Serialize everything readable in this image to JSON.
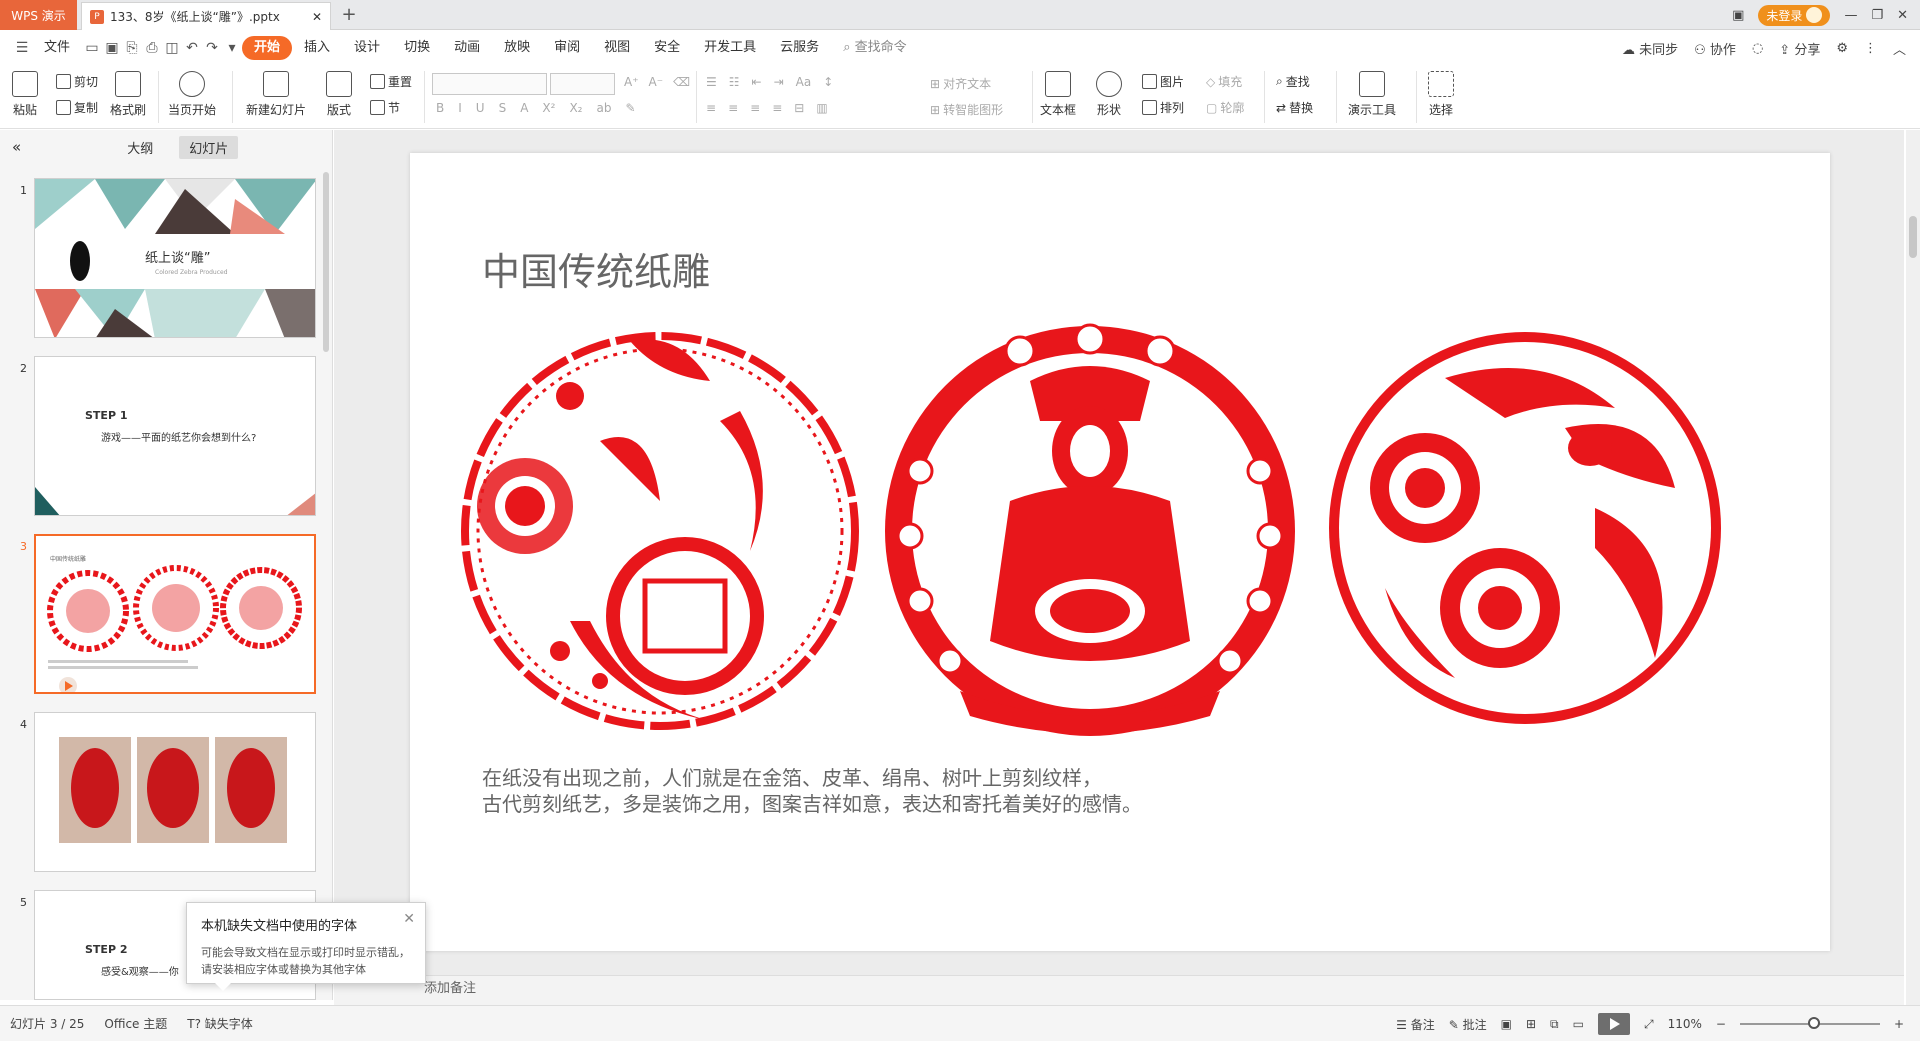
{
  "app_tab": "WPS 演示",
  "doc_tab": {
    "title": "133、8岁《纸上谈“雕”》.pptx"
  },
  "window": {
    "login_label": "未登录"
  },
  "menu": {
    "file": "文件",
    "tabs": [
      "开始",
      "插入",
      "设计",
      "切换",
      "动画",
      "放映",
      "审阅",
      "视图",
      "安全",
      "开发工具",
      "云服务"
    ],
    "active_tab": "开始",
    "search": "查找命令",
    "right": [
      "未同步",
      "协作",
      "分享"
    ]
  },
  "ribbon": {
    "paste": "粘贴",
    "cut": "剪切",
    "copy": "复制",
    "format_painter": "格式刷",
    "from_start": "当页开始",
    "new_slide": "新建幻灯片",
    "layout": "版式",
    "reset": "重置",
    "section": "节",
    "align_text": "对齐文本",
    "smart_art": "转智能图形",
    "textbox": "文本框",
    "shape": "形状",
    "picture": "图片",
    "arrange": "排列",
    "fill": "填充",
    "outline": "轮廓",
    "find": "查找",
    "replace": "替换",
    "present_tools": "演示工具",
    "select": "选择"
  },
  "panel": {
    "tabs": [
      "大纲",
      "幻灯片"
    ],
    "active": "幻灯片",
    "slides": [
      {
        "num": "1",
        "title": "纸上谈“雕”",
        "subtitle": "Colored Zebra Produced"
      },
      {
        "num": "2",
        "step": "STEP 1",
        "text": "游戏——平面的纸艺你会想到什么?"
      },
      {
        "num": "3",
        "title": "中国传统纸雕"
      },
      {
        "num": "4"
      },
      {
        "num": "5",
        "step": "STEP 2",
        "text": "感受&观察——你"
      }
    ]
  },
  "slide": {
    "title": "中国传统纸雕",
    "line1": "在纸没有出现之前，人们就是在金箔、皮革、绢帛、树叶上剪刻纹样，",
    "line2": "古代剪刻纸艺，多是装饰之用，图案吉祥如意，表达和寄托着美好的感情。",
    "accent_color": "#e8161b"
  },
  "notes_placeholder": "添加备注",
  "toast": {
    "title": "本机缺失文档中使用的字体",
    "body": "可能会导致文档在显示或打印时显示错乱，请安装相应字体或替换为其他字体"
  },
  "status": {
    "slide_counter": "幻灯片 3 / 25",
    "theme": "Office 主题",
    "missing_font": "缺失字体",
    "notes": "备注",
    "comment": "批注",
    "zoom": "110%"
  }
}
